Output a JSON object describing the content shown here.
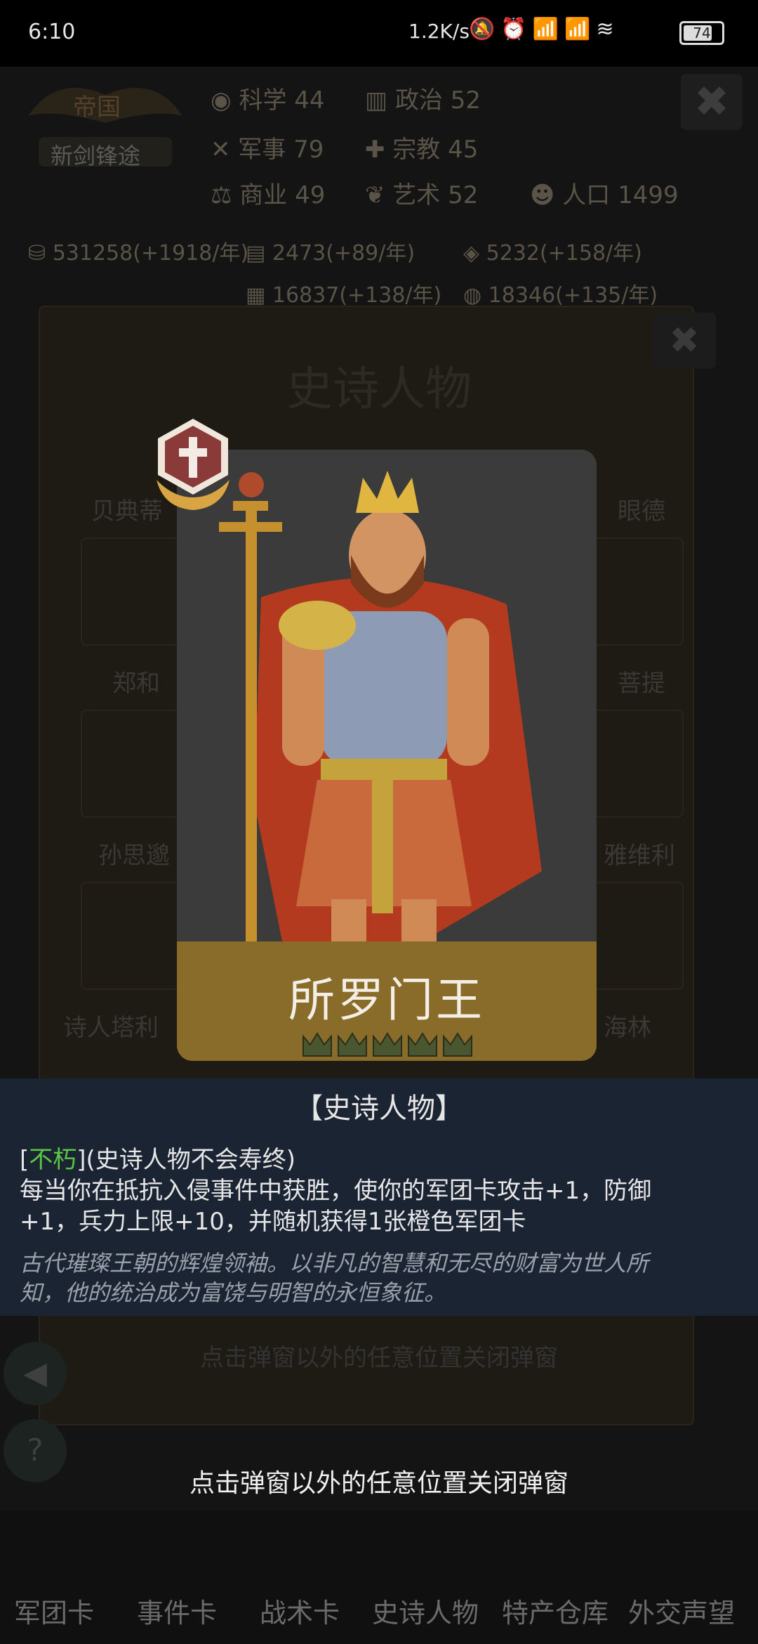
{
  "status_bar": {
    "time": "6:10",
    "net_speed": "1.2K/s",
    "battery": "74"
  },
  "background": {
    "empire_label": "帝国",
    "era_label": "新剑锋途",
    "stats": [
      {
        "icon": "science-icon",
        "label": "科学",
        "value": "44"
      },
      {
        "icon": "politics-icon",
        "label": "政治",
        "value": "52"
      },
      {
        "icon": "military-icon",
        "label": "军事",
        "value": "79"
      },
      {
        "icon": "religion-icon",
        "label": "宗教",
        "value": "45"
      },
      {
        "icon": "commerce-icon",
        "label": "商业",
        "value": "49"
      },
      {
        "icon": "art-icon",
        "label": "艺术",
        "value": "52"
      }
    ],
    "population_label": "人口",
    "population_value": "1499",
    "resources": [
      "531258(+1918/年)",
      "2473(+89/年)",
      "5232(+158/年)",
      "16837(+138/年)",
      "18346(+135/年)"
    ],
    "panel_title": "史诗人物",
    "hidden_names": [
      "贝典蒂",
      "郑和",
      "孙思邈",
      "诗人塔利",
      "眼德",
      "菩提",
      "雅维利",
      "海林"
    ],
    "hidden_hint": "点击弹窗以外的任意位置关闭弹窗",
    "bottom_tabs": [
      "军团卡",
      "事件卡",
      "战术卡",
      "史诗人物",
      "特产仓库",
      "外交声望"
    ]
  },
  "popup": {
    "character_name": "所罗门王",
    "crown_count": 5,
    "desc_title": "【史诗人物】",
    "trait_open": "[",
    "trait_name": "不朽",
    "trait_close": "]",
    "trait_note": "(史诗人物不会寿终)",
    "effect_line1": "每当你在抵抗入侵事件中获胜，使你的军团卡攻击+1，防御",
    "effect_line2": "+1，兵力上限+10，并随机获得1张橙色军团卡",
    "lore_line1": "古代璀璨王朝的辉煌领袖。以非凡的智慧和无尽的财富为世人所",
    "lore_line2": "知，他的统治成为富饶与明智的永恒象征。",
    "close_hint": "点击弹窗以外的任意位置关闭弹窗"
  },
  "colors": {
    "name_bar": "#8a6c2a",
    "trait_green": "#59c744",
    "desc_panel": "#1b2433"
  }
}
